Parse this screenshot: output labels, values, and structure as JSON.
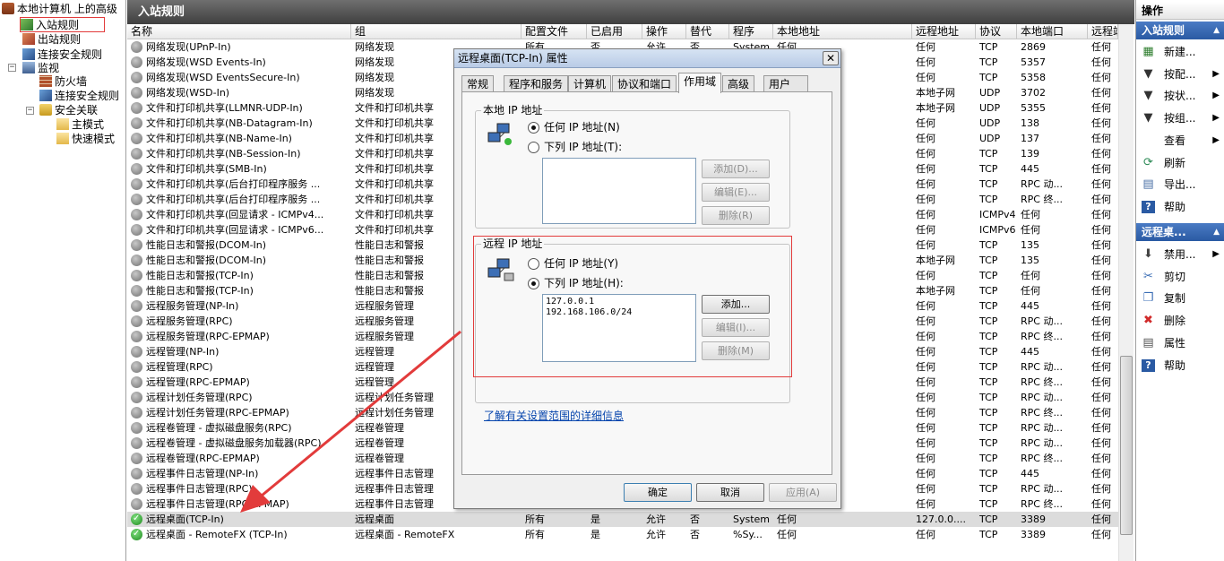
{
  "tree": {
    "root": "本地计算机 上的高级",
    "items": [
      "入站规则",
      "出站规则",
      "连接安全规则",
      "监视",
      "防火墙",
      "连接安全规则",
      "安全关联",
      "主模式",
      "快速模式"
    ]
  },
  "center": {
    "title": "入站规则",
    "columns": [
      "名称",
      "组",
      "配置文件",
      "已启用",
      "操作",
      "替代",
      "程序",
      "本地地址",
      "远程地址",
      "协议",
      "本地端口",
      "远程端"
    ],
    "rows": [
      [
        "网络发现(UPnP-In)",
        "网络发现",
        "所有",
        "否",
        "允许",
        "否",
        "System",
        "任何",
        "任何",
        "TCP",
        "2869",
        "任何"
      ],
      [
        "网络发现(WSD Events-In)",
        "网络发现",
        "",
        "",
        "",
        "",
        "",
        "",
        "任何",
        "TCP",
        "5357",
        "任何"
      ],
      [
        "网络发现(WSD EventsSecure-In)",
        "网络发现",
        "",
        "",
        "",
        "",
        "",
        "",
        "任何",
        "TCP",
        "5358",
        "任何"
      ],
      [
        "网络发现(WSD-In)",
        "网络发现",
        "",
        "",
        "",
        "",
        "",
        "",
        "本地子网",
        "UDP",
        "3702",
        "任何"
      ],
      [
        "文件和打印机共享(LLMNR-UDP-In)",
        "文件和打印机共享",
        "",
        "",
        "",
        "",
        "",
        "",
        "本地子网",
        "UDP",
        "5355",
        "任何"
      ],
      [
        "文件和打印机共享(NB-Datagram-In)",
        "文件和打印机共享",
        "",
        "",
        "",
        "",
        "",
        "",
        "任何",
        "UDP",
        "138",
        "任何"
      ],
      [
        "文件和打印机共享(NB-Name-In)",
        "文件和打印机共享",
        "",
        "",
        "",
        "",
        "",
        "",
        "任何",
        "UDP",
        "137",
        "任何"
      ],
      [
        "文件和打印机共享(NB-Session-In)",
        "文件和打印机共享",
        "",
        "",
        "",
        "",
        "",
        "",
        "任何",
        "TCP",
        "139",
        "任何"
      ],
      [
        "文件和打印机共享(SMB-In)",
        "文件和打印机共享",
        "",
        "",
        "",
        "",
        "",
        "",
        "任何",
        "TCP",
        "445",
        "任何"
      ],
      [
        "文件和打印机共享(后台打印程序服务 ...",
        "文件和打印机共享",
        "",
        "",
        "",
        "",
        "",
        "",
        "任何",
        "TCP",
        "RPC 动...",
        "任何"
      ],
      [
        "文件和打印机共享(后台打印程序服务 ...",
        "文件和打印机共享",
        "",
        "",
        "",
        "",
        "",
        "",
        "任何",
        "TCP",
        "RPC 终...",
        "任何"
      ],
      [
        "文件和打印机共享(回显请求 - ICMPv4...",
        "文件和打印机共享",
        "",
        "",
        "",
        "",
        "",
        "",
        "任何",
        "ICMPv4",
        "任何",
        "任何"
      ],
      [
        "文件和打印机共享(回显请求 - ICMPv6...",
        "文件和打印机共享",
        "",
        "",
        "",
        "",
        "",
        "",
        "任何",
        "ICMPv6",
        "任何",
        "任何"
      ],
      [
        "性能日志和警报(DCOM-In)",
        "性能日志和警报",
        "",
        "",
        "",
        "",
        "",
        "",
        "任何",
        "TCP",
        "135",
        "任何"
      ],
      [
        "性能日志和警报(DCOM-In)",
        "性能日志和警报",
        "",
        "",
        "",
        "",
        "",
        "",
        "本地子网",
        "TCP",
        "135",
        "任何"
      ],
      [
        "性能日志和警报(TCP-In)",
        "性能日志和警报",
        "",
        "",
        "",
        "",
        "",
        "",
        "任何",
        "TCP",
        "任何",
        "任何"
      ],
      [
        "性能日志和警报(TCP-In)",
        "性能日志和警报",
        "",
        "",
        "",
        "",
        "",
        "",
        "本地子网",
        "TCP",
        "任何",
        "任何"
      ],
      [
        "远程服务管理(NP-In)",
        "远程服务管理",
        "",
        "",
        "",
        "",
        "",
        "",
        "任何",
        "TCP",
        "445",
        "任何"
      ],
      [
        "远程服务管理(RPC)",
        "远程服务管理",
        "",
        "",
        "",
        "",
        "",
        "",
        "任何",
        "TCP",
        "RPC 动...",
        "任何"
      ],
      [
        "远程服务管理(RPC-EPMAP)",
        "远程服务管理",
        "",
        "",
        "",
        "",
        "",
        "",
        "任何",
        "TCP",
        "RPC 终...",
        "任何"
      ],
      [
        "远程管理(NP-In)",
        "远程管理",
        "",
        "",
        "",
        "",
        "",
        "",
        "任何",
        "TCP",
        "445",
        "任何"
      ],
      [
        "远程管理(RPC)",
        "远程管理",
        "",
        "",
        "",
        "",
        "",
        "",
        "任何",
        "TCP",
        "RPC 动...",
        "任何"
      ],
      [
        "远程管理(RPC-EPMAP)",
        "远程管理",
        "",
        "",
        "",
        "",
        "",
        "",
        "任何",
        "TCP",
        "RPC 终...",
        "任何"
      ],
      [
        "远程计划任务管理(RPC)",
        "远程计划任务管理",
        "",
        "",
        "",
        "",
        "",
        "",
        "任何",
        "TCP",
        "RPC 动...",
        "任何"
      ],
      [
        "远程计划任务管理(RPC-EPMAP)",
        "远程计划任务管理",
        "",
        "",
        "",
        "",
        "",
        "",
        "任何",
        "TCP",
        "RPC 终...",
        "任何"
      ],
      [
        "远程卷管理 - 虚拟磁盘服务(RPC)",
        "远程卷管理",
        "",
        "",
        "",
        "",
        "",
        "",
        "任何",
        "TCP",
        "RPC 动...",
        "任何"
      ],
      [
        "远程卷管理 - 虚拟磁盘服务加载器(RPC)",
        "远程卷管理",
        "",
        "",
        "",
        "",
        "",
        "",
        "任何",
        "TCP",
        "RPC 动...",
        "任何"
      ],
      [
        "远程卷管理(RPC-EPMAP)",
        "远程卷管理",
        "",
        "",
        "",
        "",
        "",
        "",
        "任何",
        "TCP",
        "RPC 终...",
        "任何"
      ],
      [
        "远程事件日志管理(NP-In)",
        "远程事件日志管理",
        "",
        "",
        "",
        "",
        "",
        "",
        "任何",
        "TCP",
        "445",
        "任何"
      ],
      [
        "远程事件日志管理(RPC)",
        "远程事件日志管理",
        "",
        "",
        "",
        "",
        "",
        "",
        "任何",
        "TCP",
        "RPC 动...",
        "任何"
      ],
      [
        "远程事件日志管理(RPC-EPMAP)",
        "远程事件日志管理",
        "",
        "",
        "",
        "",
        "",
        "",
        "任何",
        "TCP",
        "RPC 终...",
        "任何"
      ],
      [
        "远程桌面(TCP-In)",
        "远程桌面",
        "所有",
        "是",
        "允许",
        "否",
        "System",
        "任何",
        "127.0.0....",
        "TCP",
        "3389",
        "任何"
      ],
      [
        "远程桌面 - RemoteFX (TCP-In)",
        "远程桌面 - RemoteFX",
        "所有",
        "是",
        "允许",
        "否",
        "%Sy...",
        "任何",
        "任何",
        "TCP",
        "3389",
        "任何"
      ]
    ]
  },
  "actions": {
    "header": "操作",
    "section1": "入站规则",
    "items1": [
      "新建...",
      "按配...",
      "按状...",
      "按组...",
      "查看",
      "刷新",
      "导出...",
      "帮助"
    ],
    "section2": "远程桌...",
    "items2": [
      "禁用...",
      "剪切",
      "复制",
      "删除",
      "属性",
      "帮助"
    ]
  },
  "dialog": {
    "title": "远程桌面(TCP-In) 属性",
    "close": "✕",
    "tabs": [
      "常规",
      "程序和服务",
      "计算机",
      "协议和端口",
      "作用域",
      "高级",
      "用户"
    ],
    "local_group": "本地 IP 地址",
    "local_any": "任何 IP 地址(N)",
    "local_list": "下列 IP 地址(T):",
    "remote_group": "远程 IP 地址",
    "remote_any": "任何 IP 地址(Y)",
    "remote_list": "下列 IP 地址(H):",
    "remote_entries": [
      "127.0.0.1",
      "192.168.106.0/24"
    ],
    "btn_add_local": "添加(D)...",
    "btn_edit_local": "编辑(E)...",
    "btn_del_local": "删除(R)",
    "btn_add_remote": "添加...",
    "btn_edit_remote": "编辑(I)...",
    "btn_del_remote": "删除(M)",
    "link": "了解有关设置范围的详细信息",
    "ok": "确定",
    "cancel": "取消",
    "apply": "应用(A)"
  },
  "colors": {
    "annotation": "#e23b3b",
    "title_bar": "#4a4a4a",
    "selected_row": "#dcdcdc"
  }
}
